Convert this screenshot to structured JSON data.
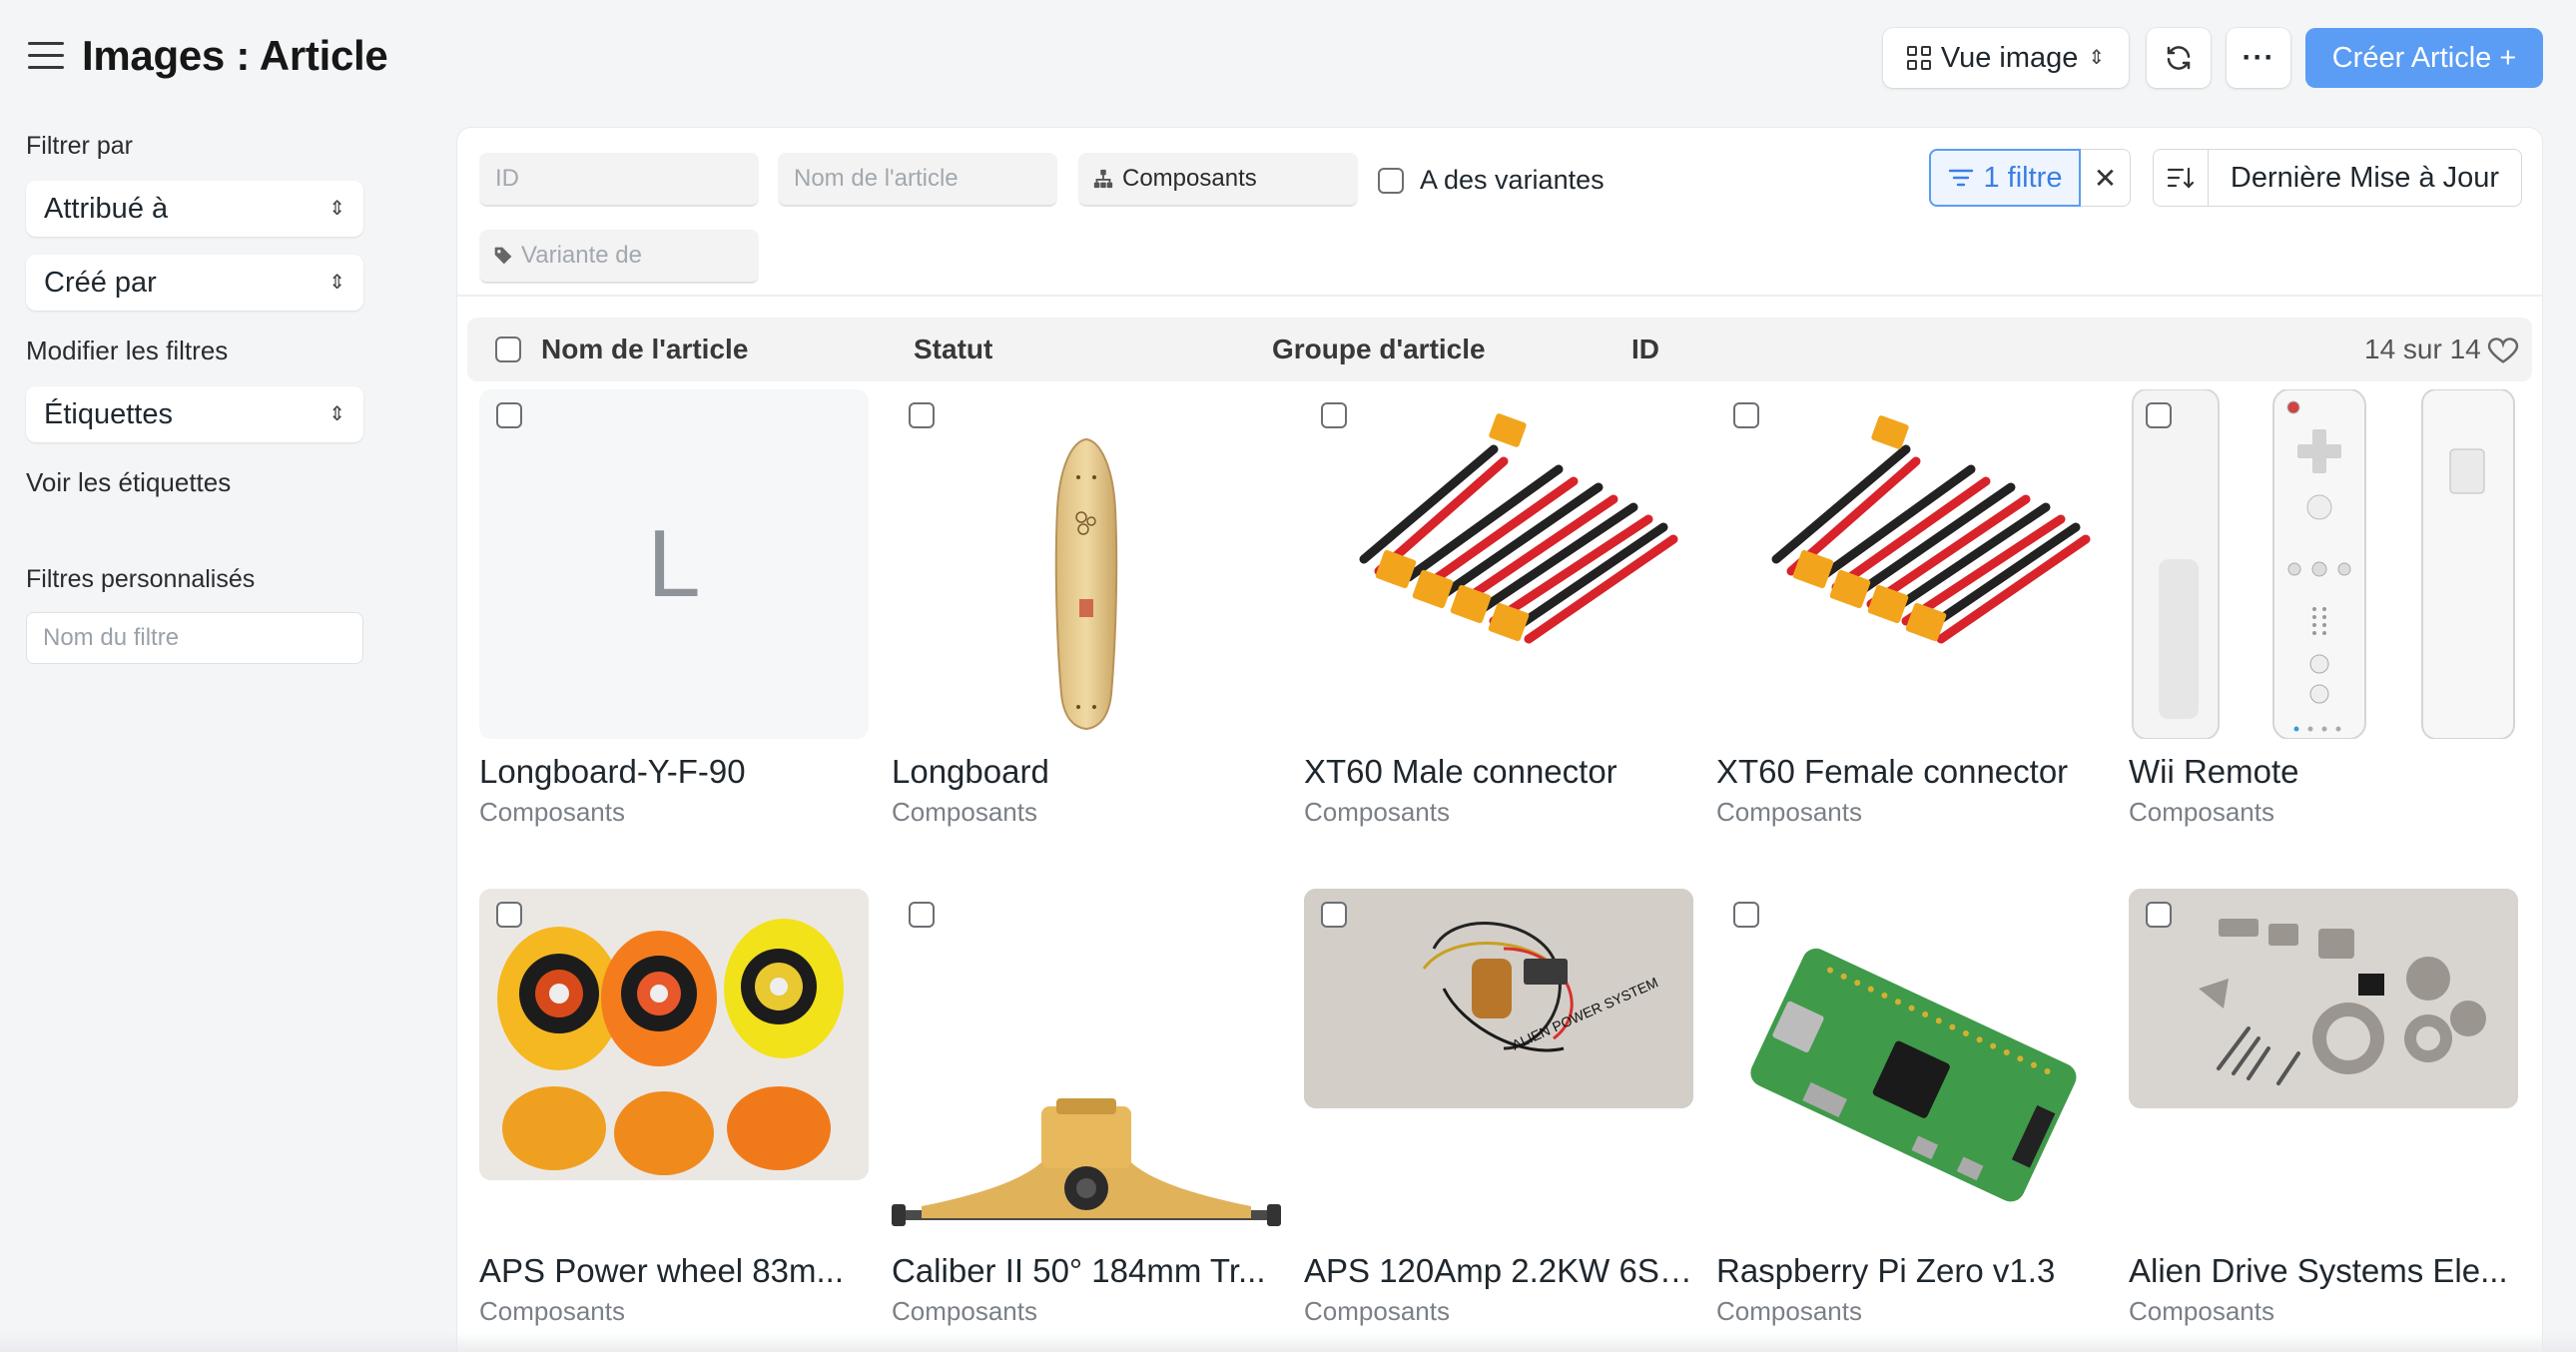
{
  "header": {
    "title": "Images : Article",
    "view_label": "Vue image",
    "create_label": "Créer Article +",
    "more_label": "···"
  },
  "sidebar": {
    "filter_by": "Filtrer par",
    "assigned_to": "Attribué à",
    "created_by": "Créé par",
    "edit_filters": "Modifier les filtres",
    "tags": "Étiquettes",
    "show_tags": "Voir les étiquettes",
    "custom_filters": "Filtres personnalisés",
    "filter_name_placeholder": "Nom du filtre"
  },
  "filters": {
    "id_placeholder": "ID",
    "item_name_placeholder": "Nom de l'article",
    "item_group_value": "Composants",
    "has_variants_label": "A des variantes",
    "variant_of_placeholder": "Variante de",
    "active_filter_label": "1 filtre",
    "sort_label": "Dernière Mise à Jour"
  },
  "list_header": {
    "item_name": "Nom de l'article",
    "status": "Statut",
    "item_group": "Groupe d'article",
    "id": "ID",
    "count": "14 sur 14"
  },
  "items": [
    {
      "title": "Longboard-Y-F-90",
      "group": "Composants",
      "image": "letter-placeholder",
      "letter": "L"
    },
    {
      "title": "Longboard",
      "group": "Composants",
      "image": "longboard-deck"
    },
    {
      "title": "XT60 Male connector",
      "group": "Composants",
      "image": "xt60-cables"
    },
    {
      "title": "XT60 Female connector",
      "group": "Composants",
      "image": "xt60-cables"
    },
    {
      "title": "Wii Remote",
      "group": "Composants",
      "image": "wii-remote"
    },
    {
      "title": "APS Power wheel 83m...",
      "group": "Composants",
      "image": "wheels"
    },
    {
      "title": "Caliber II 50° 184mm Tr...",
      "group": "Composants",
      "image": "truck"
    },
    {
      "title": "APS 120Amp 2.2KW 6S ...",
      "group": "Composants",
      "image": "motor-esc"
    },
    {
      "title": "Raspberry Pi Zero v1.3",
      "group": "Composants",
      "image": "raspberry-pi"
    },
    {
      "title": "Alien Drive Systems Ele...",
      "group": "Composants",
      "image": "metal-parts"
    }
  ],
  "colors": {
    "primary": "#5b9cf4",
    "background": "#f4f5f7"
  }
}
